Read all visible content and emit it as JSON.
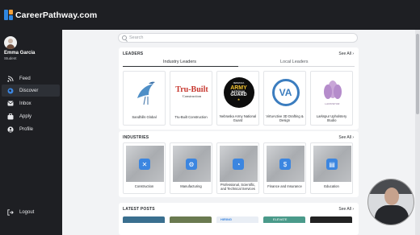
{
  "brand": {
    "name": "CareerPathway.com"
  },
  "user": {
    "name": "Emma Garcia",
    "role": "Student"
  },
  "nav": [
    {
      "label": "Feed",
      "icon": "rss-icon"
    },
    {
      "label": "Discover",
      "icon": "globe-icon"
    },
    {
      "label": "Inbox",
      "icon": "mail-icon"
    },
    {
      "label": "Apply",
      "icon": "briefcase-icon"
    },
    {
      "label": "Profile",
      "icon": "user-icon"
    }
  ],
  "logout": {
    "label": "Logout",
    "icon": "logout-icon"
  },
  "search": {
    "placeholder": "Search",
    "value": ""
  },
  "leaders": {
    "title": "LEADERS",
    "see_all": "See All",
    "tabs": [
      "Industry Leaders",
      "Local Leaders"
    ],
    "items": [
      {
        "name": "Sandhills Global",
        "logo": "heron-logo"
      },
      {
        "name": "Tru-Built Construction",
        "logo": "trubuilt-logo",
        "logo_text": "Tru-Built",
        "logo_sub": "Construction"
      },
      {
        "name": "Nebraska Army National Guard",
        "logo": "army-guard-logo",
        "logo_top": "NEBRASKA",
        "logo_army": "ARMY",
        "logo_national": "NATIONAL",
        "logo_guard": "GUARD"
      },
      {
        "name": "VirtuActive 3D Drafting & Design",
        "logo": "va-logo",
        "logo_text": "VA"
      },
      {
        "name": "Larkspur Upholstery Studio",
        "logo": "larkspur-logo",
        "logo_text": "LARKSPUR"
      }
    ]
  },
  "industries": {
    "title": "INDUSTRIES",
    "see_all": "See All",
    "items": [
      {
        "name": "Construction",
        "icon": "tools-icon"
      },
      {
        "name": "Manufacturing",
        "icon": "robot-arm-icon"
      },
      {
        "name": "Professional, Scientific, and Technical Services",
        "icon": "gauge-icon"
      },
      {
        "name": "Finance and Insurance",
        "icon": "piggy-bank-icon"
      },
      {
        "name": "Education",
        "icon": "book-icon"
      }
    ]
  },
  "posts": {
    "title": "LATEST POSTS",
    "see_all": "See All",
    "thumbs": [
      "HIRING",
      "ELEVATE"
    ]
  },
  "colors": {
    "accent": "#3c86e0",
    "sidebar": "#1e1f23",
    "content_bg": "#f2f3f5"
  }
}
